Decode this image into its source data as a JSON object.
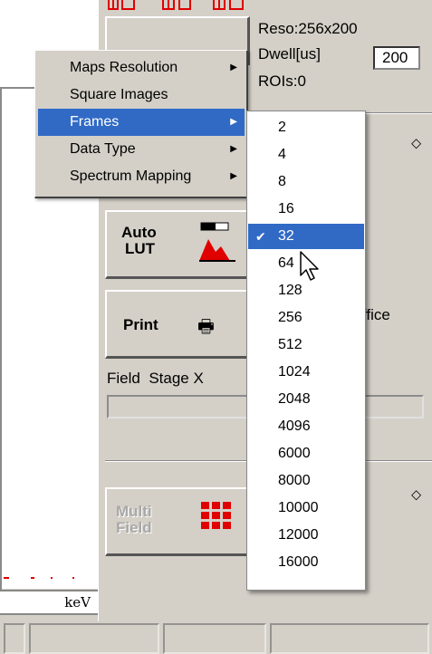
{
  "info": {
    "resolution": "Reso:256x200",
    "dwell_label": "Dwell[us]",
    "dwell_value": "200",
    "rois": "ROIs:0"
  },
  "buttons": {
    "auto_lut_line1": "Auto",
    "auto_lut_line2": "LUT",
    "print": "Print",
    "multi_field_line1": "Multi",
    "multi_field_line2": "Field"
  },
  "field_row": {
    "field_label": "Field",
    "stage_label": "Stage X"
  },
  "partial_text": "ffice",
  "kev_label": "keV",
  "menu": {
    "items": [
      {
        "label": "Maps Resolution",
        "has_submenu": true
      },
      {
        "label": "Square Images",
        "has_submenu": false
      },
      {
        "label": "Frames",
        "has_submenu": true,
        "highlighted": true
      },
      {
        "label": "Data Type",
        "has_submenu": true
      },
      {
        "label": "Spectrum Mapping",
        "has_submenu": true
      }
    ]
  },
  "frames_submenu": {
    "checked": "32",
    "options": [
      "2",
      "4",
      "8",
      "16",
      "32",
      "64",
      "128",
      "256",
      "512",
      "1024",
      "2048",
      "4096",
      "6000",
      "8000",
      "10000",
      "12000",
      "16000"
    ]
  },
  "colors": {
    "menu_highlight": "#316ac5",
    "window_bg": "#d4d0c8",
    "lut_red": "#e00000"
  }
}
